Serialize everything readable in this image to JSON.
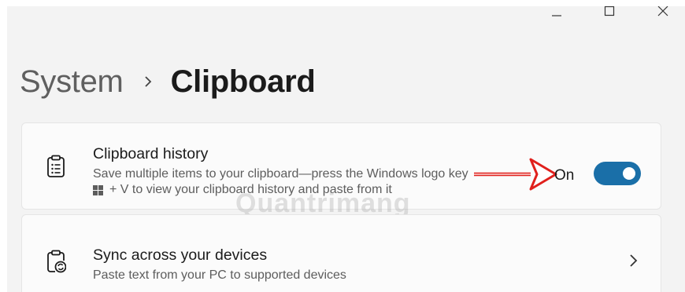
{
  "window": {
    "controls": {
      "minimize_icon": "minimize-icon",
      "maximize_icon": "maximize-icon",
      "close_icon": "close-icon"
    }
  },
  "breadcrumb": {
    "parent": "System",
    "current": "Clipboard"
  },
  "clipboard_history": {
    "icon": "clipboard-list-icon",
    "title": "Clipboard history",
    "description_line1": "Save multiple items to your clipboard—press the Windows logo key",
    "description_line2": "+ V to view your clipboard history and paste from it",
    "toggle_state_label": "On",
    "toggle_on": true
  },
  "sync": {
    "icon": "clipboard-sync-icon",
    "title": "Sync across your devices",
    "description": "Paste text from your PC to supported devices"
  },
  "watermark": "Quantrimang",
  "colors": {
    "accent": "#1a6fa8",
    "annotation_arrow": "#e0201c",
    "background": "#f3f3f3",
    "card": "#fbfbfb"
  }
}
